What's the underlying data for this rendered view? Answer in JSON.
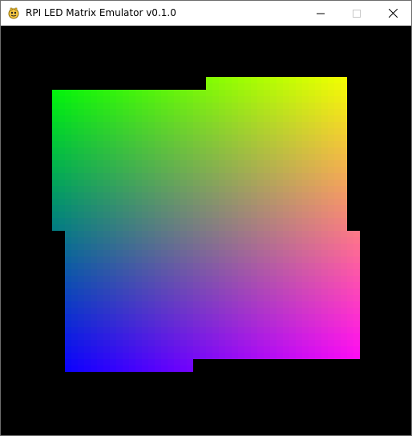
{
  "window": {
    "title": "RPI LED Matrix Emulator v0.1.0",
    "controls": [
      "minimize",
      "maximize",
      "close"
    ]
  },
  "canvas": {
    "background": "#000000"
  },
  "matrix": {
    "description_colors": {
      "top_left": "#00ff00",
      "top_right": "#ffff00",
      "bottom_left": "#0000ff",
      "bottom_right": "#ff00ff"
    },
    "panels": 4
  }
}
